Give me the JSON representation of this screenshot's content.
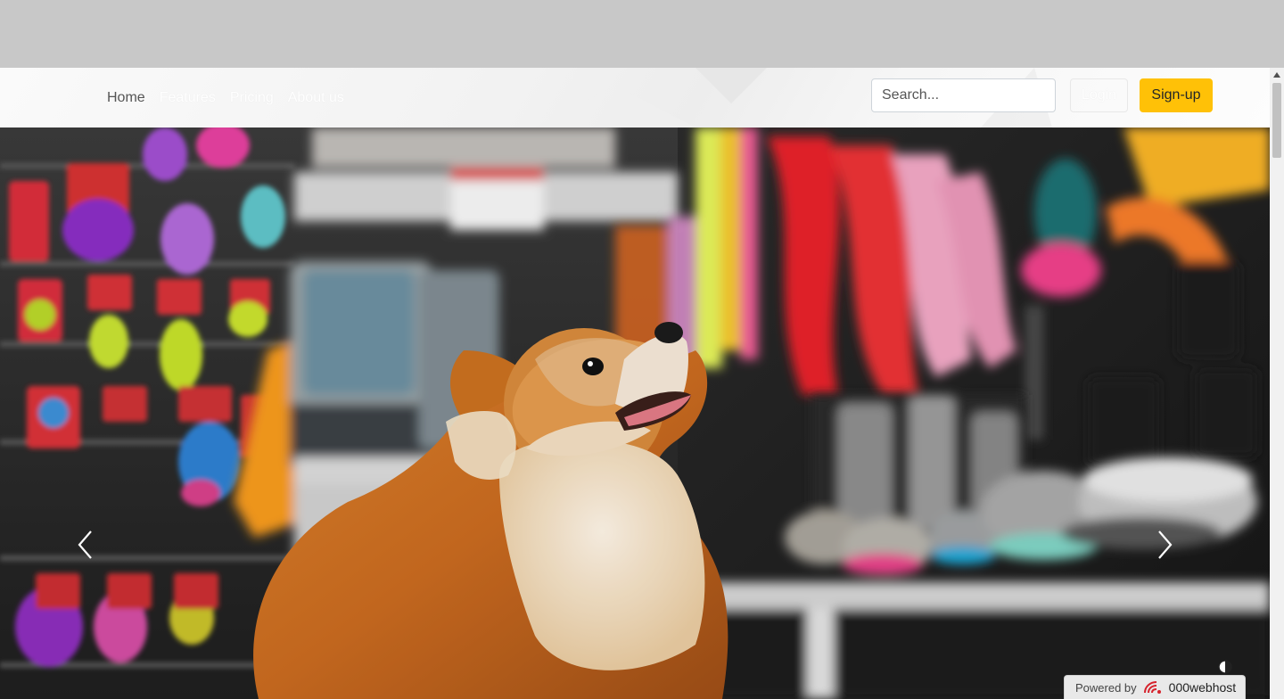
{
  "nav": {
    "links": [
      {
        "label": "Home"
      },
      {
        "label": "Features"
      },
      {
        "label": "Pricing"
      },
      {
        "label": "About us"
      }
    ],
    "search_placeholder": "Search...",
    "login_label": "Login",
    "signup_label": "Sign-up"
  },
  "hero": {
    "image": "dog-in-pet-store-photo",
    "prev_icon": "chevron-left-icon",
    "next_icon": "chevron-right-icon"
  },
  "footer_badge": {
    "prefix": "Powered by",
    "brand": "000webhost",
    "icon": "000webhost-logo-icon"
  },
  "colors": {
    "accent": "#ffc107",
    "page_background": "#c8c8c8"
  }
}
